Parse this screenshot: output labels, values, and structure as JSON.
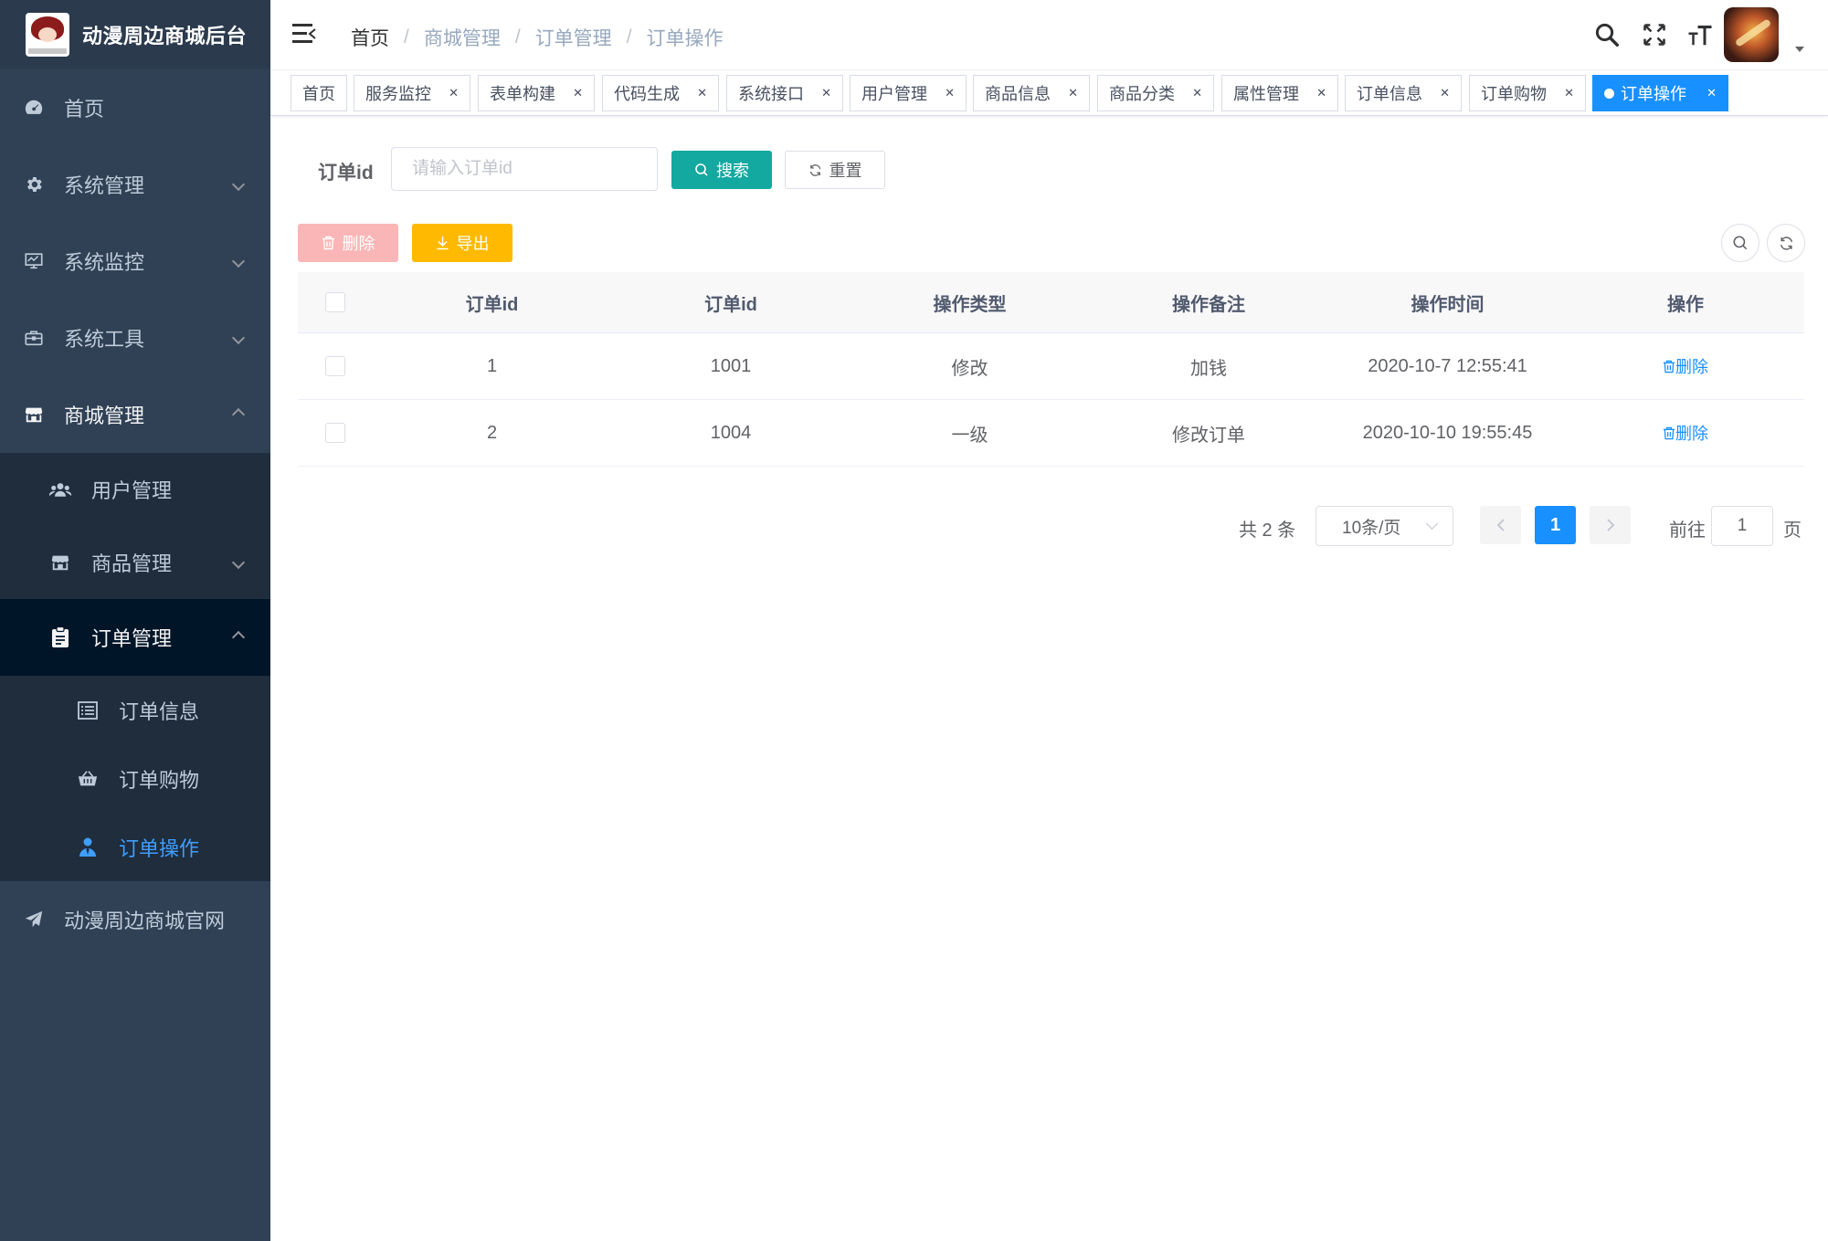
{
  "app": {
    "title": "动漫周边商城后台"
  },
  "sidebar": {
    "items": [
      {
        "label": "首页",
        "icon": "dashboard-icon"
      },
      {
        "label": "系统管理",
        "icon": "gear-icon"
      },
      {
        "label": "系统监控",
        "icon": "monitor-icon"
      },
      {
        "label": "系统工具",
        "icon": "toolbox-icon"
      },
      {
        "label": "商城管理",
        "icon": "store-icon",
        "expanded": true,
        "children": [
          {
            "label": "用户管理",
            "icon": "users-icon"
          },
          {
            "label": "商品管理",
            "icon": "store-icon"
          },
          {
            "label": "订单管理",
            "icon": "clipboard-icon",
            "expanded": true,
            "children": [
              {
                "label": "订单信息",
                "icon": "list-icon"
              },
              {
                "label": "订单购物",
                "icon": "basket-icon"
              },
              {
                "label": "订单操作",
                "icon": "user-tie-icon",
                "active": true
              }
            ]
          }
        ]
      },
      {
        "label": "动漫周边商城官网",
        "icon": "paper-plane-icon"
      }
    ]
  },
  "breadcrumb": [
    "首页",
    "商城管理",
    "订单管理",
    "订单操作"
  ],
  "tags": [
    "首页",
    "服务监控",
    "表单构建",
    "代码生成",
    "系统接口",
    "用户管理",
    "商品信息",
    "商品分类",
    "属性管理",
    "订单信息",
    "订单购物",
    "订单操作"
  ],
  "search": {
    "label": "订单id",
    "placeholder": "请输入订单id",
    "value": "",
    "search_btn": "搜索",
    "reset_btn": "重置"
  },
  "toolbar": {
    "delete_btn": "删除",
    "export_btn": "导出"
  },
  "table": {
    "headers": [
      "订单id",
      "订单id",
      "操作类型",
      "操作备注",
      "操作时间",
      "操作"
    ],
    "rows": [
      {
        "col1": "1",
        "col2": "1001",
        "type": "修改",
        "remark": "加钱",
        "time": "2020-10-7 12:55:41",
        "action": "删除"
      },
      {
        "col1": "2",
        "col2": "1004",
        "type": "一级",
        "remark": "修改订单",
        "time": "2020-10-10 19:55:45",
        "action": "删除"
      }
    ]
  },
  "pagination": {
    "total_text": "共 2 条",
    "page_size": "10条/页",
    "current_page": "1",
    "goto_label": "前往",
    "goto_value": "1",
    "goto_unit": "页"
  },
  "colors": {
    "sidebar_bg": "#304156",
    "active_tag": "#1890ff",
    "search_btn": "#13a8a0",
    "export_btn": "#ffba00",
    "delete_btn": "#fab6b6"
  }
}
